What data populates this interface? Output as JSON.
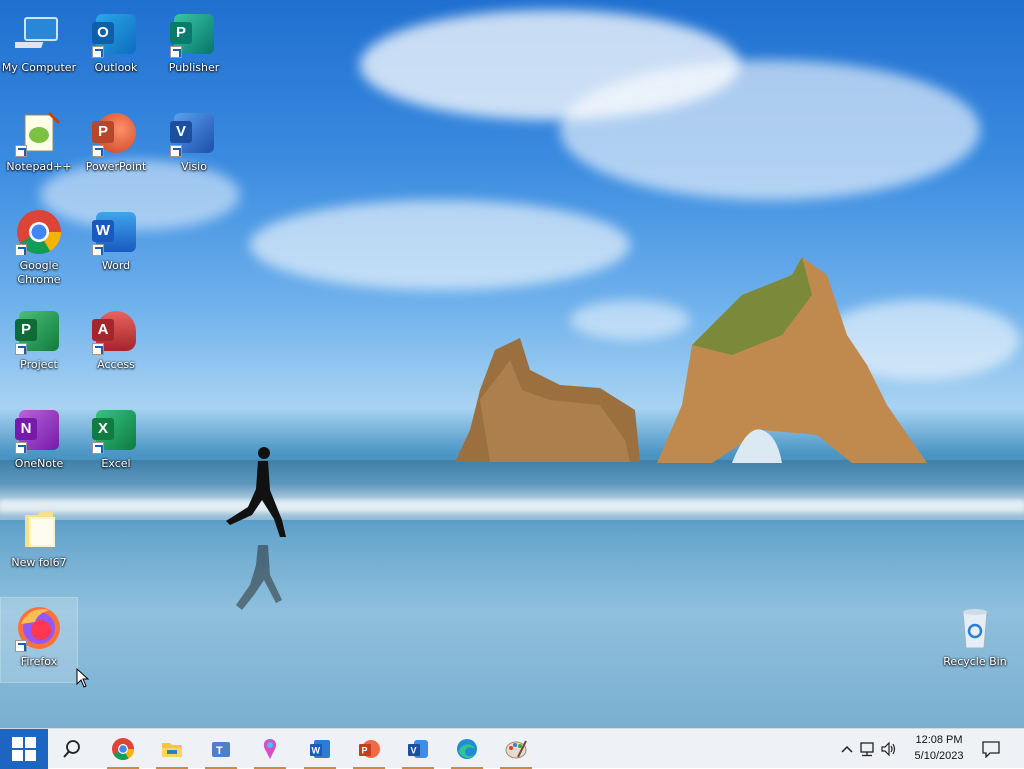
{
  "desktop": {
    "icons": [
      {
        "label": "My Computer",
        "icon": "computer-icon"
      },
      {
        "label": "Outlook",
        "icon": "outlook-icon"
      },
      {
        "label": "Publisher",
        "icon": "publisher-icon"
      },
      {
        "label": "Notepad++",
        "icon": "notepadpp-icon"
      },
      {
        "label": "PowerPoint",
        "icon": "powerpoint-icon"
      },
      {
        "label": "Visio",
        "icon": "visio-icon"
      },
      {
        "label": "Google Chrome",
        "icon": "chrome-icon"
      },
      {
        "label": "Word",
        "icon": "word-icon"
      },
      {
        "label": "Project",
        "icon": "project-icon"
      },
      {
        "label": "Access",
        "icon": "access-icon"
      },
      {
        "label": "OneNote",
        "icon": "onenote-icon"
      },
      {
        "label": "Excel",
        "icon": "excel-icon"
      },
      {
        "label": "New fol67",
        "icon": "folder-icon"
      },
      {
        "label": "Firefox",
        "icon": "firefox-icon"
      },
      {
        "label": "Recycle Bin",
        "icon": "recycle-bin-icon"
      }
    ]
  },
  "taskbar": {
    "apps": [
      "windows-start-icon",
      "search-icon",
      "chrome-icon",
      "file-explorer-icon",
      "teams-icon",
      "paint3d-icon",
      "word-icon",
      "powerpoint-icon",
      "visio-icon",
      "edge-icon",
      "paint-icon"
    ],
    "time": "12:08 PM",
    "date": "5/10/2023"
  },
  "colors": {
    "taskbar_bg": "#eef1f5",
    "start_bg": "#1c66c2",
    "accent_underline": "#d08a3c"
  }
}
